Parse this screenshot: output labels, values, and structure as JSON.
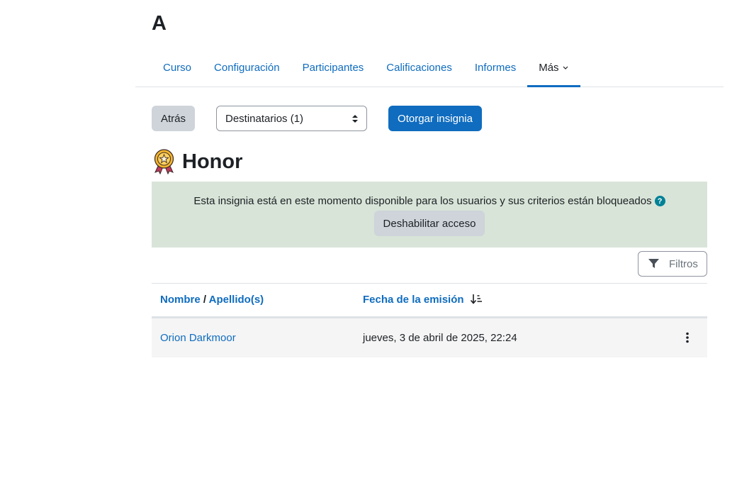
{
  "course": {
    "title": "A"
  },
  "nav": {
    "tabs": [
      {
        "label": "Curso"
      },
      {
        "label": "Configuración"
      },
      {
        "label": "Participantes"
      },
      {
        "label": "Calificaciones"
      },
      {
        "label": "Informes"
      },
      {
        "label": "Más"
      }
    ],
    "active": "Más"
  },
  "actions": {
    "back_label": "Atrás",
    "select_value": "Destinatarios (1)",
    "award_label": "Otorgar insignia"
  },
  "badge": {
    "name": "Honor",
    "icon": "badge-medal-icon"
  },
  "alert": {
    "message": "Esta insignia está en este momento disponible para los usuarios y sus criterios están bloqueados",
    "help_icon_text": "?",
    "disable_label": "Deshabilitar acceso",
    "background": "#d8e4d8"
  },
  "filters": {
    "label": "Filtros"
  },
  "table": {
    "headers": {
      "first_name": "Nombre",
      "separator": "/",
      "last_name": "Apellido(s)",
      "date": "Fecha de la emisión"
    },
    "rows": [
      {
        "name": "Orion Darkmoor",
        "date": "jueves, 3 de abril de 2025, 22:24"
      }
    ]
  },
  "colors": {
    "primary": "#0f6cbf",
    "secondary": "#ced4da",
    "info": "#008196"
  }
}
